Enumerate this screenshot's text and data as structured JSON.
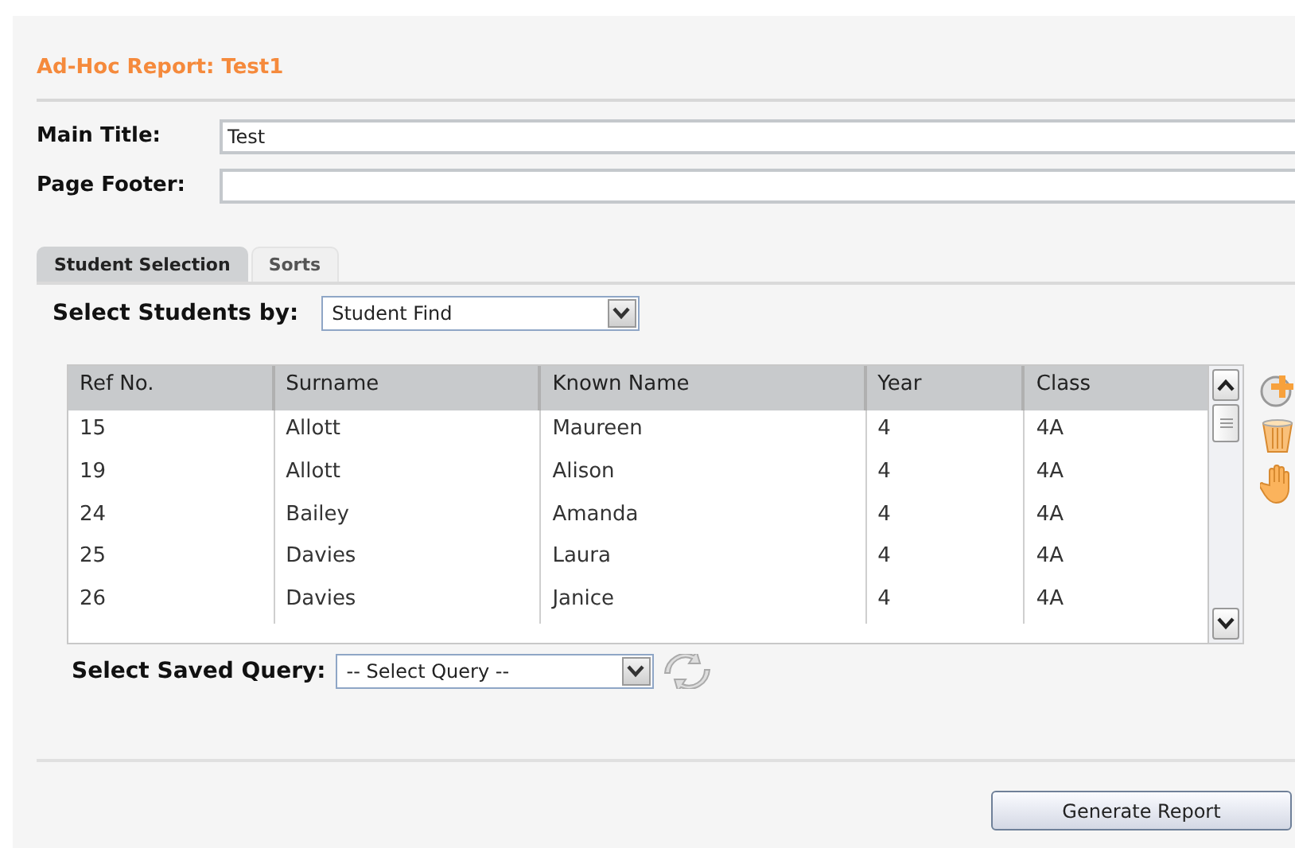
{
  "title": "Ad-Hoc Report: Test1",
  "fields": [
    {
      "label": "Main Title:",
      "value": "Test"
    },
    {
      "label": "Page Footer:"
    }
  ],
  "tabs": [
    {
      "label": "Student Selection",
      "selected": true
    },
    {
      "label": "Sorts",
      "selected": false
    }
  ],
  "select_by": {
    "label": "Select Students by:",
    "value": "Student Find"
  },
  "table": {
    "columns": [
      "Ref No.",
      "Surname",
      "Known Name",
      "Year",
      "Class"
    ],
    "rows": [
      [
        "15",
        "Allott",
        "Maureen",
        "4",
        "4A"
      ],
      [
        "19",
        "Allott",
        "Alison",
        "4",
        "4A"
      ],
      [
        "24",
        "Bailey",
        "Amanda",
        "4",
        "4A"
      ],
      [
        "25",
        "Davies",
        "Laura",
        "4",
        "4A"
      ],
      [
        "26",
        "Davies",
        "Janice",
        "4",
        "4A"
      ]
    ]
  },
  "saved_query": {
    "label": "Select Saved Query:",
    "value": "-- Select Query --"
  },
  "buttons": [
    "Generate Report"
  ]
}
